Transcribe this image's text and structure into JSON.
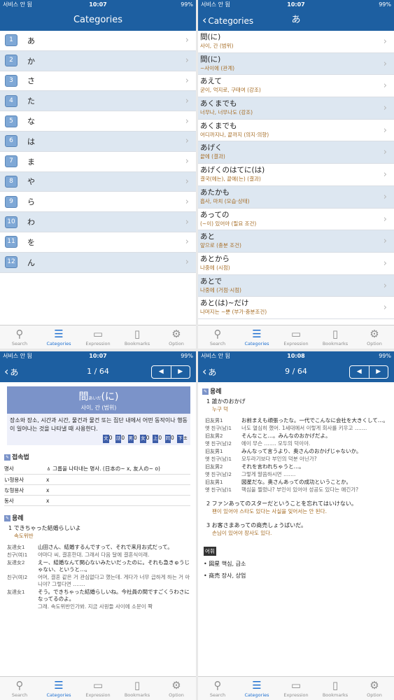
{
  "status": {
    "carrier": "서비스 안 됨",
    "battery": "99%",
    "times": [
      "10:07",
      "10:07",
      "10:07",
      "10:08"
    ]
  },
  "tabs": [
    {
      "label": "Search",
      "icon": "search-icon",
      "glyph": "⚲"
    },
    {
      "label": "Categories",
      "icon": "categories-icon",
      "glyph": "☰"
    },
    {
      "label": "Expression",
      "icon": "expression-icon",
      "glyph": "▭"
    },
    {
      "label": "Bookmarks",
      "icon": "bookmarks-icon",
      "glyph": "▯"
    },
    {
      "label": "Option",
      "icon": "gear-icon",
      "glyph": "⚙"
    }
  ],
  "accent_color": "#1d5fa1",
  "screen1": {
    "title": "Categories",
    "items": [
      {
        "n": "1",
        "label": "あ"
      },
      {
        "n": "2",
        "label": "か"
      },
      {
        "n": "3",
        "label": "さ"
      },
      {
        "n": "4",
        "label": "た"
      },
      {
        "n": "5",
        "label": "な"
      },
      {
        "n": "6",
        "label": "は"
      },
      {
        "n": "7",
        "label": "ま"
      },
      {
        "n": "8",
        "label": "や"
      },
      {
        "n": "9",
        "label": "ら"
      },
      {
        "n": "10",
        "label": "わ"
      },
      {
        "n": "11",
        "label": "を"
      },
      {
        "n": "12",
        "label": "ん"
      }
    ]
  },
  "screen2": {
    "back": "Categories",
    "title": "あ",
    "items": [
      {
        "jp": "間(に)",
        "ko": "사이, 간 (범위)"
      },
      {
        "jp": "間(に)",
        "ko": "~사이에 (관계)"
      },
      {
        "jp": "あえて",
        "ko": "굳이, 억지로, 구태여 (강조)"
      },
      {
        "jp": "あくまでも",
        "ko": "너무나, 너무나도 (강조)"
      },
      {
        "jp": "あくまでも",
        "ko": "어디까지나, 끝까지 (의지·의향)"
      },
      {
        "jp": "あげく",
        "ko": "끝에 (결과)"
      },
      {
        "jp": "あげくのはてに(は)",
        "ko": "결국(에는), 끝에(는) (결과)"
      },
      {
        "jp": "あたかも",
        "ko": "흡사, 마치 (모습·상태)"
      },
      {
        "jp": "あっての",
        "ko": "(~이) 있어야 (필요 조건)"
      },
      {
        "jp": "あと",
        "ko": "앞으로 (충분 조건)"
      },
      {
        "jp": "あとから",
        "ko": "나중에 (시점)"
      },
      {
        "jp": "あとで",
        "ko": "나중에 (거점·시점)"
      },
      {
        "jp": "あと(は)~だけ",
        "ko": "나머지는 ~뿐 (부가·충분조건)"
      }
    ]
  },
  "screen3": {
    "back": "あ",
    "page": "1 / 64",
    "head_word": "間",
    "head_furi": "あいだ",
    "head_tail": "(に)",
    "head_sub": "사이, 간 (범위)",
    "description": "장소와 장소, 시간과 시간, 물건과 물건 또는 집단 내에서 어떤 동작이나 행동이 일어나는 것을 나타낼 때 사용한다.",
    "usage": [
      {
        "tag": "文",
        "v": "0"
      },
      {
        "tag": "話",
        "v": "0"
      },
      {
        "tag": "男",
        "v": "0"
      },
      {
        "tag": "女",
        "v": "0"
      },
      {
        "tag": "上",
        "v": "0"
      },
      {
        "tag": "同",
        "v": "0"
      },
      {
        "tag": "下",
        "v": "±"
      }
    ],
    "section_conn": "접속법",
    "conn": [
      {
        "k": "명사",
        "v": "ㅿ 그룹을 나타내는 명사. (日本の~ x, 友人の~ o)"
      },
      {
        "k": "い형용사",
        "v": "x"
      },
      {
        "k": "な형용사",
        "v": "x"
      },
      {
        "k": "동사",
        "v": "x"
      }
    ],
    "section_ex": "용례",
    "ex_title": "1  できちゃった結婚らしいよ",
    "ex_sub": "속도위반",
    "dialog": [
      {
        "sp": "友達女1",
        "jp": "山田さん、結婚するんですって、それで来月お式だって。"
      },
      {
        "sp": "친구(여)1",
        "jp": "야마다 씨, 결혼한대. 그래서 다음 달에 결혼식이래."
      },
      {
        "sp": "友達女2",
        "jp": "えー、結婚なんて関心ないみたいだったのに。それも急きゅうじゃない、というと…。"
      },
      {
        "sp": "친구(여)2",
        "jp": "어머, 결혼 같은 거 관심없다고 했는데. 게다가 너무 급하게 하는 거 아니야? 그렇다면 ……."
      },
      {
        "sp": "友達女1",
        "jp": "そう。できちゃった結婚らしいね。今社員の間ですごくうわさになってるのよ。"
      },
      {
        "sp": "",
        "jp": "그래. 속도위반인가봐. 지금 사원들 사이에 소문이 쫙"
      }
    ]
  },
  "screen4": {
    "back": "あ",
    "page": "9 / 64",
    "section_ex": "용례",
    "ex1_title": "1  誰かのおかげ",
    "ex1_sub": "누구 덕",
    "dialog1": [
      {
        "sp": "旧友男1",
        "jp": "お前まえも頑張ったな。一代でこんなに会社を大きくして…。"
      },
      {
        "sp": "옛 친구(남)1",
        "jp": "너도 열심히 했어. 1세대에서 이렇게 회사를 키우고 ……."
      },
      {
        "sp": "旧友男2",
        "jp": "そんなこと…。みんなのおかげだよ。"
      },
      {
        "sp": "옛 친구(남)2",
        "jp": "에이 무슨 ……. 모두의 덕이야."
      },
      {
        "sp": "旧友男1",
        "jp": "みんなって言うより、奥さんのおかげじゃないか。"
      },
      {
        "sp": "옛 친구(남)1",
        "jp": "모두라기보다 부인의 덕분 아닌가?"
      },
      {
        "sp": "旧友男2",
        "jp": "それを言われちゃうと…。"
      },
      {
        "sp": "옛 친구(남)2",
        "jp": "그렇게 말씀하시면 ……."
      },
      {
        "sp": "旧友男1",
        "jp": "図星だな。奥さんあっての成功ということか。"
      },
      {
        "sp": "옛 친구(남)1",
        "jp": "핵심을 찔렀나? 부인이 있어야 성공도 있다는 얘긴가?"
      }
    ],
    "ex2_jp": "2  ファンあってのスターだということを忘れてはいけない。",
    "ex2_ko": "팬이 있어야 스타도 있다는 사실을 잊어서는 안 된다.",
    "ex3_jp": "3  お客さまあっての商売しょうばいだ。",
    "ex3_ko": "손님이 있어야 장사도 있다.",
    "vocab_head": "어휘",
    "vocab": [
      "• 図星 핵심, 급소",
      "• 商売 장사, 상업"
    ]
  }
}
